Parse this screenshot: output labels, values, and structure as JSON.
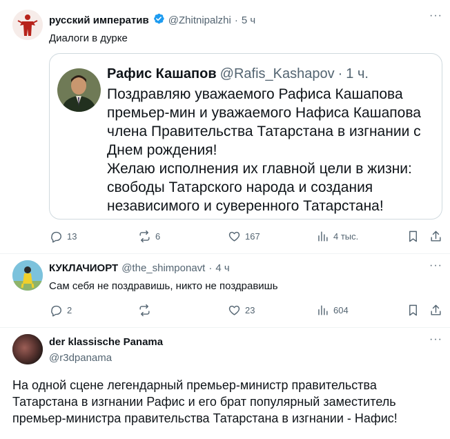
{
  "posts": [
    {
      "author": "русский императив",
      "handle": "@Zhitnipalzhi",
      "separator": "·",
      "time": "5 ч",
      "text": "Диалоги в дурке",
      "quote": {
        "author": "Рафис Кашапов",
        "handle": "@Rafis_Kashapov",
        "separator": "·",
        "time": "1 ч.",
        "lines": [
          "Поздравляю уважаемого Рафиса Кашапова",
          "премьер-мин и уважаемого Нафиса Кашапова",
          "члена Правительства Татарстана в изгнании с",
          "Днем рождения!",
          "Желаю исполнения их главной цели в жизни:",
          "свободы Татарского народа и создания",
          "независимого и суверенного Татарстана!"
        ]
      },
      "replies": "13",
      "reposts": "6",
      "likes": "167",
      "views": "4 тыс."
    },
    {
      "author": "КУКЛАЧИОРТ",
      "handle": "@the_shimponavt",
      "separator": "·",
      "time": "4 ч",
      "text": "Сам себя не поздравишь, никто не поздравишь",
      "replies": "2",
      "reposts": "",
      "likes": "23",
      "views": "604"
    },
    {
      "author": "der klassische Panama",
      "handle": "@r3dpanama",
      "lines": [
        "На одной сцене легендарный премьер-министр правительства",
        "Татарстана в изгнании Рафис и его брат популярный заместитель",
        "премьер-министра правительства Татарстана в изгнании - Нафис!"
      ]
    }
  ],
  "icons": {
    "more": "more-icon",
    "reply": "reply-icon",
    "repost": "repost-icon",
    "like": "like-icon",
    "views": "views-icon",
    "bookmark": "bookmark-icon",
    "share": "share-icon",
    "verified": "verified-badge-icon"
  },
  "colors": {
    "text": "#0f1419",
    "secondary": "#536471",
    "verified": "#1d9bf0",
    "border": "#cfd9de",
    "divider": "#eff3f4"
  }
}
